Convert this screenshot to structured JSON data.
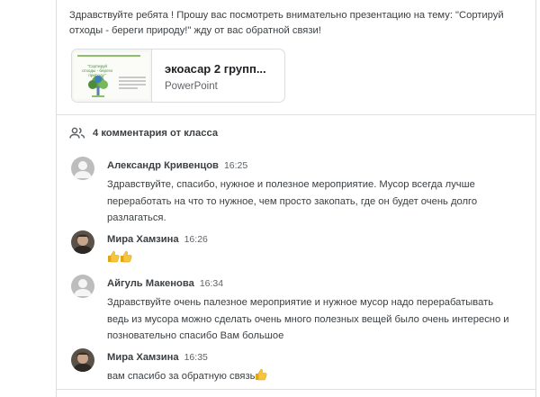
{
  "post": {
    "message": "Здравствуйте ребята ! Прошу вас  посмотреть внимательно презентацию на тему:    \"Сортируй отходы - береги природу!\" жду от вас обратной связи!",
    "attachment": {
      "name": "экоасар 2 групп...",
      "type": "PowerPoint",
      "thumbnail_title": "\"Сортируй отходы - береги природу\""
    }
  },
  "comments_header": {
    "label": "4 комментария от класса",
    "icon": "people-icon"
  },
  "comments": [
    {
      "author": "Александр Кривенцов",
      "time": "16:25",
      "text": "Здравствуйте, спасибо, нужное и полезное мероприятие. Мусор всегда лучше переработать на что то нужное, чем просто закопать, где он будет очень долго разлагаться.",
      "avatar": "default-avatar-icon"
    },
    {
      "author": "Мира Хамзина",
      "time": "16:26",
      "text": "",
      "emoji": "thumbs-up-icon ×2",
      "avatar": "photo-avatar"
    },
    {
      "author": "Айгуль Макенова",
      "time": "16:34",
      "text": "Здравствуйте очень палезное мероприятие и нужное мусор надо перерабатывать ведь из мусора можно сделать очень много полезных вещей было очень интересно и позновательно спасибо Вам большое",
      "avatar": "default-avatar-icon"
    },
    {
      "author": "Мира Хамзина",
      "time": "16:35",
      "text": "вам спасибо за обратную связь",
      "emoji": "thumbs-up-icon",
      "avatar": "photo-avatar"
    }
  ],
  "colors": {
    "text": "#3c4043",
    "muted": "#5f6368",
    "divider": "#e0e0e0",
    "thumb": "#f5c63a"
  }
}
